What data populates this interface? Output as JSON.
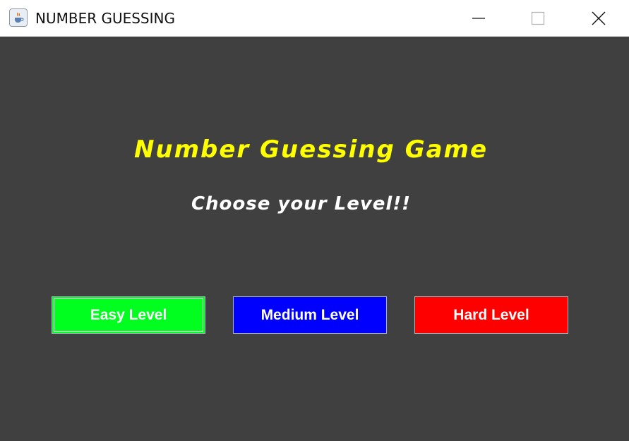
{
  "window": {
    "title": "NUMBER GUESSING",
    "app_icon": "java-cup-icon",
    "controls": {
      "minimize_icon": "minimize-icon",
      "maximize_icon": "maximize-icon",
      "close_icon": "close-icon"
    }
  },
  "main": {
    "title": "Number Guessing Game",
    "subtitle": "Choose your Level!!",
    "buttons": [
      {
        "label": "Easy Level",
        "color": "#00ff1e"
      },
      {
        "label": "Medium Level",
        "color": "#0000ff"
      },
      {
        "label": "Hard Level",
        "color": "#ff0000"
      }
    ]
  },
  "colors": {
    "background": "#404040",
    "title_text": "#ffff00",
    "subtitle_text": "#ffffff",
    "titlebar": "#ffffff"
  }
}
